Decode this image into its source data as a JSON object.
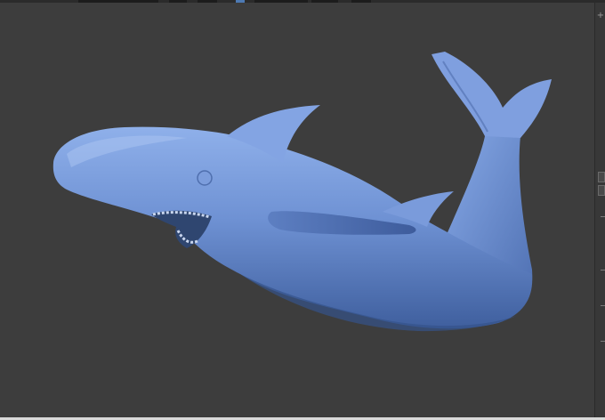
{
  "viewport": {
    "background": "#3d3d3d",
    "model_color": "#6f8fcc"
  },
  "icons": {
    "corner": "plus-icon"
  }
}
